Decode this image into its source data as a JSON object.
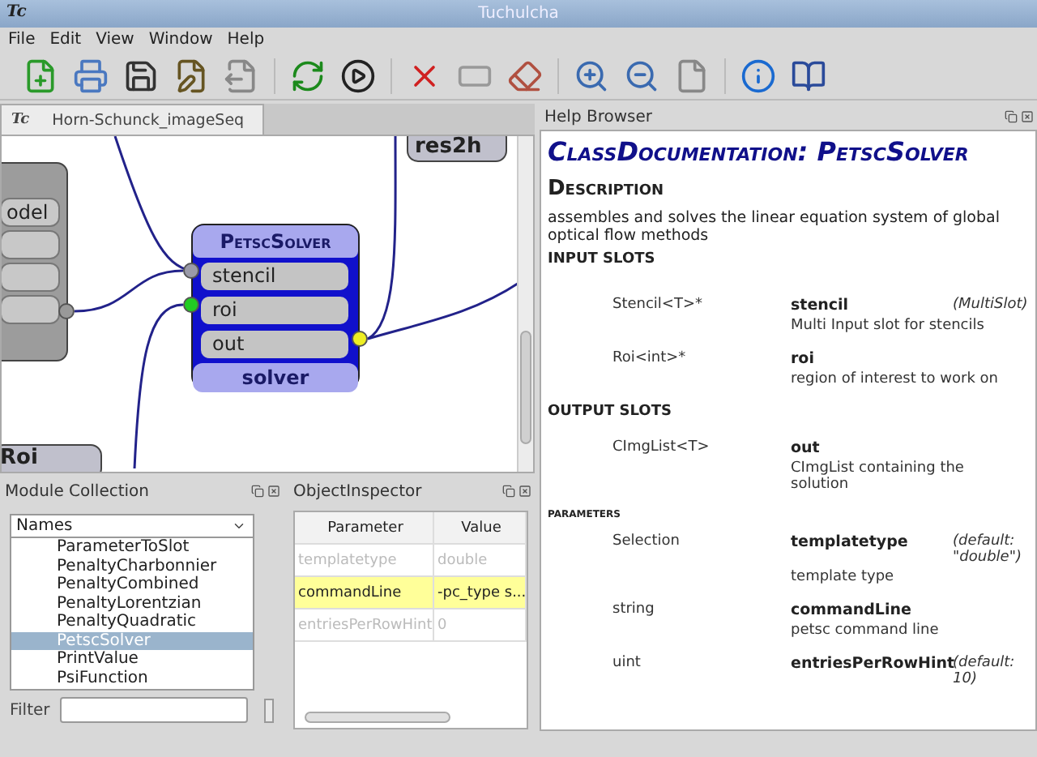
{
  "window": {
    "title": "Tuchulcha",
    "logo": "Tc"
  },
  "menu": [
    {
      "label": "File"
    },
    {
      "label": "Edit"
    },
    {
      "label": "View"
    },
    {
      "label": "Window"
    },
    {
      "label": "Help"
    }
  ],
  "graph_tab": {
    "logo": "Tc",
    "label": "Horn-Schunck_imageSeq",
    "selected": true
  },
  "graph": {
    "node": {
      "title": "PetscSolver",
      "footer": "solver",
      "slots": [
        {
          "name": "stencil",
          "color": "#9a9aa8"
        },
        {
          "name": "roi",
          "color": "#22cc22"
        },
        {
          "name": "out",
          "color": "#eeee22"
        }
      ]
    },
    "left_node_slot": "odel",
    "bottom_node": "Roi",
    "top_node": "res2h"
  },
  "help": {
    "title": "Help Browser",
    "heading": "ClassDocumentation: PetscSolver",
    "description_heading": "Description",
    "description": "assembles and solves the linear equation system of global optical flow methods",
    "input_heading": "INPUT SLOTS",
    "inputs": [
      {
        "type": "Stencil<T>*",
        "name": "stencil",
        "note": "(MultiSlot)",
        "text": "Multi Input slot for stencils"
      },
      {
        "type": "Roi<int>*",
        "name": "roi",
        "text": "region of interest to work on"
      }
    ],
    "output_heading": "OUTPUT SLOTS",
    "outputs": [
      {
        "type": "CImgList<T>",
        "name": "out",
        "text": "CImgList containing the solution"
      }
    ],
    "parameters_heading": "PARAMETERS",
    "parameters": [
      {
        "type": "Selection",
        "name": "templatetype",
        "note": "(default: \"double\")",
        "text": "template type"
      },
      {
        "type": "string",
        "name": "commandLine",
        "text": "petsc command line"
      },
      {
        "type": "uint",
        "name": "entriesPerRowHint",
        "note": "(default: 10)"
      }
    ]
  },
  "modules": {
    "title": "Module Collection",
    "header": "Names",
    "filter_label": "Filter",
    "items": [
      {
        "label": "ParameterToSlot",
        "selected": false
      },
      {
        "label": "PenaltyCharbonnier",
        "selected": false
      },
      {
        "label": "PenaltyCombined",
        "selected": false
      },
      {
        "label": "PenaltyLorentzian",
        "selected": false
      },
      {
        "label": "PenaltyQuadratic",
        "selected": false
      },
      {
        "label": "PetscSolver",
        "selected": true
      },
      {
        "label": "PrintValue",
        "selected": false
      },
      {
        "label": "PsiFunction",
        "selected": false
      }
    ]
  },
  "inspector": {
    "title": "ObjectInspector",
    "columns": [
      "Parameter",
      "Value"
    ],
    "rows": [
      {
        "parameter": "templatetype",
        "value": "double",
        "selected": false,
        "disabled": true
      },
      {
        "parameter": "commandLine",
        "value": "-pc_type s...",
        "selected": true,
        "disabled": false
      },
      {
        "parameter": "entriesPerRowHint",
        "value": "0",
        "selected": false,
        "disabled": true
      }
    ]
  }
}
